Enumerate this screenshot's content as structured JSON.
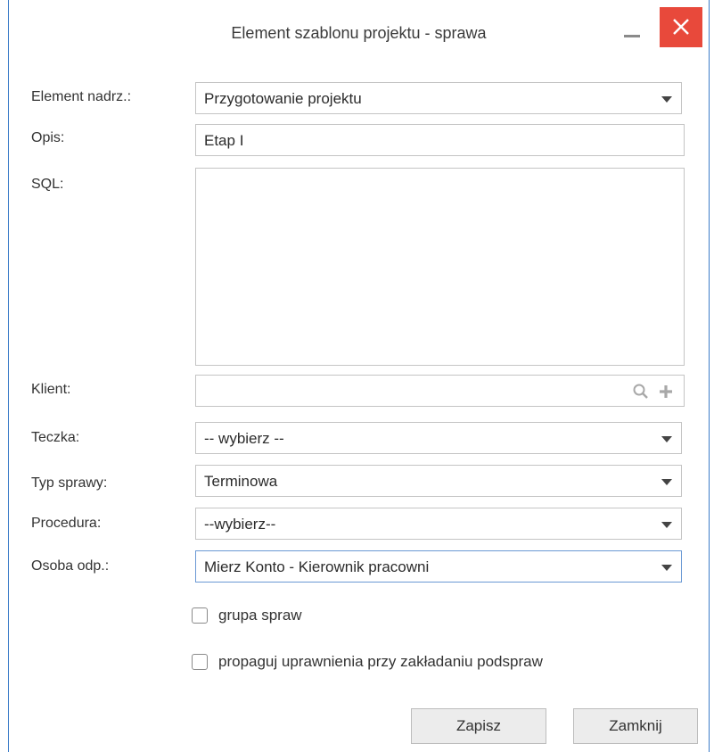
{
  "dialog": {
    "title": "Element szablonu projektu - sprawa",
    "minimize_icon": "minimize-icon",
    "close_icon": "close-icon",
    "close_color": "#e8493b"
  },
  "form": {
    "parent": {
      "label": "Element nadrz.:",
      "value": "Przygotowanie projektu"
    },
    "opis": {
      "label": "Opis:",
      "value": "Etap I"
    },
    "sql": {
      "label": "SQL:",
      "value": ""
    },
    "klient": {
      "label": "Klient:",
      "value": "",
      "icons": [
        "search-icon",
        "plus-icon"
      ]
    },
    "teczka": {
      "label": "Teczka:",
      "value": "-- wybierz --"
    },
    "typ": {
      "label": "Typ sprawy:",
      "value": "Terminowa"
    },
    "procedura": {
      "label": "Procedura:",
      "value": "--wybierz--"
    },
    "osoba": {
      "label": "Osoba odp.:",
      "value": "Mierz Konto - Kierownik pracowni"
    }
  },
  "checkboxes": {
    "grupa": {
      "label": "grupa spraw",
      "checked": false
    },
    "propaguj": {
      "label": "propaguj uprawnienia przy zakładaniu podspraw",
      "checked": false
    }
  },
  "buttons": {
    "save": "Zapisz",
    "close": "Zamknij"
  }
}
